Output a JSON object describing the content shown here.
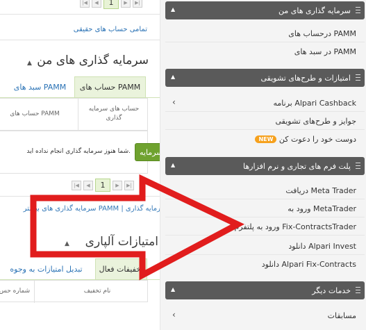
{
  "left": {
    "pager_top": {
      "page": "1",
      "icons": [
        "first-page-icon",
        "prev-page-icon",
        "next-page-icon",
        "last-page-icon"
      ]
    },
    "all_real_accounts_link": "تمامی حساب های حقیقی",
    "investments_title": "سرمایه گذاری های من",
    "tabs": [
      {
        "label": "حساب های PAMM"
      },
      {
        "label": "سبد های PAMM"
      }
    ],
    "table_headers": [
      "حساب های سرمایه گذاری",
      "حساب های PAMM"
    ],
    "empty_message": "شما هنوز سرمایه گذاری انجام نداده اید.",
    "invest_button": "سرمایه",
    "pager_bottom": {
      "page": "1"
    },
    "bottom_links": "سرمایه گذاری های بیشتر PAMM | سرمایه گذاری",
    "bonus_title": "امتیازات آلپاری",
    "bonus_tabs": [
      {
        "label": "تخفیفات فعال"
      },
      {
        "label": "تبدیل امتیازات به وجوه"
      }
    ],
    "bonus_headers": [
      "نام تخفیف",
      "شماره حس"
    ]
  },
  "sidebar": {
    "sections": [
      {
        "title": "سرمایه گذاری های من",
        "items": [
          "درحساب های PAMM",
          "در سبد های PAMM"
        ]
      },
      {
        "title": "امتیازات و طرح‌های تشویقی",
        "items": [
          "برنامه Alpari Cashback",
          "جوایز و طرح‌های تشویقی",
          "دوست خود را دعوت کن"
        ],
        "badge": "NEW"
      },
      {
        "title": "پلت فرم های تجاری و نرم افزارها",
        "items": [
          "دریافت Meta Trader",
          "ورود به MetaTrader",
          "ورود به پلتفرم Fix-ContractsTrader",
          "دانلود Alpari Invest",
          "دانلود Alpari Fix-Contracts"
        ]
      },
      {
        "title": "خدمات دیگر",
        "items": [
          "مسابقات"
        ]
      }
    ]
  },
  "colors": {
    "header_bg": "#5a5a5a",
    "accent_green": "#6fa22f",
    "link_blue": "#2a72b5",
    "arrow_red": "#e11d1d",
    "badge_orange": "#f6a11d"
  }
}
